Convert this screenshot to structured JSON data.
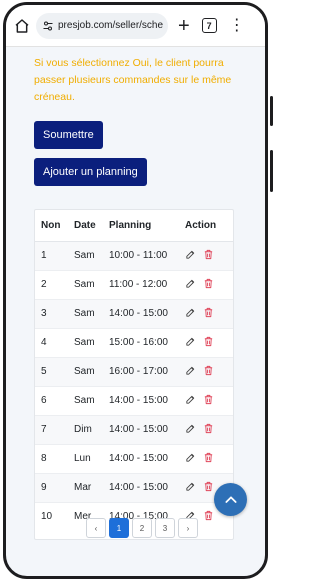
{
  "browser": {
    "url": "presjob.com/seller/sche",
    "tab_count": "7"
  },
  "notice": "Si vous sélectionnez Oui, le client pourra passer plusieurs commandes sur le même créneau.",
  "buttons": {
    "submit": "Soumettre",
    "add_schedule": "Ajouter un planning"
  },
  "table": {
    "headers": [
      "Non",
      "Date",
      "Planning",
      "Action"
    ],
    "rows": [
      {
        "num": "1",
        "date": "Sam",
        "slot": "10:00 - 11:00"
      },
      {
        "num": "2",
        "date": "Sam",
        "slot": "11:00 - 12:00"
      },
      {
        "num": "3",
        "date": "Sam",
        "slot": "14:00 - 15:00"
      },
      {
        "num": "4",
        "date": "Sam",
        "slot": "15:00 - 16:00"
      },
      {
        "num": "5",
        "date": "Sam",
        "slot": "16:00 - 17:00"
      },
      {
        "num": "6",
        "date": "Sam",
        "slot": "14:00 - 15:00"
      },
      {
        "num": "7",
        "date": "Dim",
        "slot": "14:00 - 15:00"
      },
      {
        "num": "8",
        "date": "Lun",
        "slot": "14:00 - 15:00"
      },
      {
        "num": "9",
        "date": "Mar",
        "slot": "14:00 - 15:00"
      },
      {
        "num": "10",
        "date": "Mer",
        "slot": "14:00 - 15:00"
      }
    ]
  },
  "pagination": {
    "prev": "‹",
    "pages": [
      "1",
      "2",
      "3"
    ],
    "next": "›",
    "current": "1"
  },
  "colors": {
    "notice": "#f0ad00",
    "primary_button": "#0b1f7d",
    "edit_icon": "#444444",
    "delete_icon": "#e0455a",
    "fab": "#2d6fb6",
    "active_page": "#1e6fd9"
  },
  "icons": {
    "home": "home-icon",
    "site_settings": "tune-icon",
    "new_tab": "plus-icon",
    "menu": "more-vert-icon",
    "edit": "edit-icon",
    "delete": "trash-icon",
    "back_to_top": "chevron-up-icon"
  }
}
